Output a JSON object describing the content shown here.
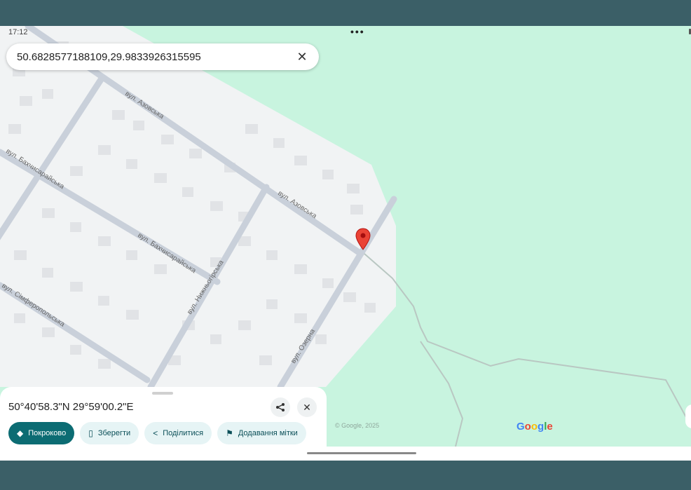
{
  "status": {
    "time": "17:12",
    "dots": "•••"
  },
  "search": {
    "value": "50.6828577188109,29.9833926315595",
    "close_icon": "close-icon"
  },
  "map": {
    "streets": [
      {
        "id": "azovska-1",
        "label": "вул. Азовська"
      },
      {
        "id": "azovska-2",
        "label": "вул. Азовська"
      },
      {
        "id": "bakhchysaraiska-1",
        "label": "вул. Бахчисарайська"
      },
      {
        "id": "bakhchysaraiska-2",
        "label": "вул. Бахчисарайська"
      },
      {
        "id": "nyzhnohirska",
        "label": "вул. Нижньогірська"
      },
      {
        "id": "simferopolska",
        "label": "вул. Сімферопольська"
      },
      {
        "id": "ozerna",
        "label": "вул. Озерна"
      }
    ],
    "copyright": "© Google, 2025",
    "logo": "Google",
    "colors": {
      "forest": "#c8f4df",
      "residential": "#f1f3f4",
      "road": "#c9d0da",
      "pin": "#ea4335"
    }
  },
  "sheet": {
    "coordinates": "50°40'58.3\"N 29°59'00.2\"E",
    "actions": [
      {
        "label": "Покроково",
        "icon": "directions-icon",
        "primary": true
      },
      {
        "label": "Зберегти",
        "icon": "bookmark-icon",
        "primary": false
      },
      {
        "label": "Поділитися",
        "icon": "share-icon",
        "primary": false
      },
      {
        "label": "Додавання мітки",
        "icon": "flag-icon",
        "primary": false
      }
    ]
  }
}
